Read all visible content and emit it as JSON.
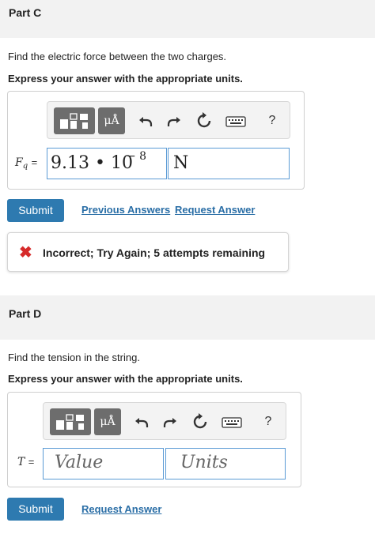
{
  "part_c": {
    "title": "Part C",
    "prompt": "Find the electric force between the two charges.",
    "instruction": "Express your answer with the appropriate units.",
    "toolbar": {
      "templates_icon": "templates-icon",
      "units_label": "μÅ",
      "undo_icon": "undo-icon",
      "redo_icon": "redo-icon",
      "reset_icon": "reset-icon",
      "keyboard_icon": "keyboard-icon",
      "help_label": "?"
    },
    "variable": "F",
    "variable_sub": "q",
    "equals": "=",
    "value_mantissa": "9.13 • 10",
    "value_exponent": "− 8",
    "units_value": "N",
    "submit_label": "Submit",
    "previous_answers_label": "Previous Answers",
    "request_answer_label": "Request Answer",
    "feedback": {
      "icon": "x-icon",
      "color": "#d62a2a",
      "message": "Incorrect; Try Again; 5 attempts remaining"
    }
  },
  "part_d": {
    "title": "Part D",
    "prompt": "Find the tension in the string.",
    "instruction": "Express your answer with the appropriate units.",
    "toolbar": {
      "templates_icon": "templates-icon",
      "units_label": "μÅ",
      "undo_icon": "undo-icon",
      "redo_icon": "redo-icon",
      "reset_icon": "reset-icon",
      "keyboard_icon": "keyboard-icon",
      "help_label": "?"
    },
    "variable": "T",
    "equals": "=",
    "value_placeholder": "Value",
    "units_placeholder": "Units",
    "submit_label": "Submit",
    "request_answer_label": "Request Answer"
  },
  "colors": {
    "accent": "#2e7ab0",
    "link": "#2a6ea6",
    "field_border": "#5b9bd5",
    "toolbar_button": "#6d6d6d"
  }
}
